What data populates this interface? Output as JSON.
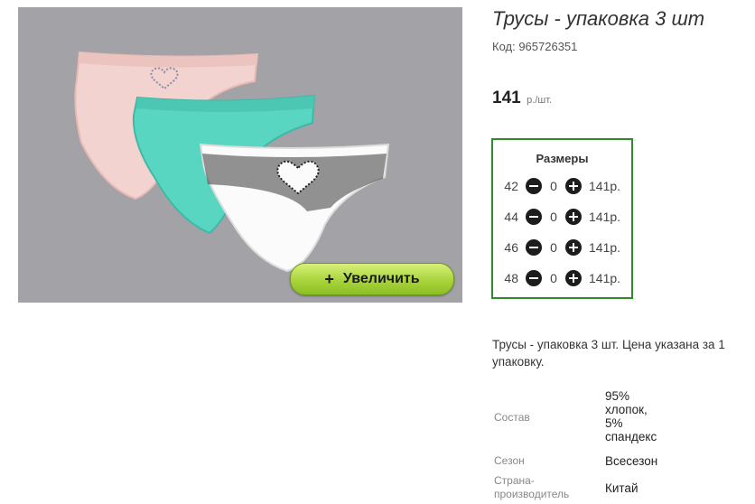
{
  "product": {
    "title": "Трусы - упаковка 3 шт",
    "sku": "Код: 965726351",
    "price": "141",
    "price_unit": "р./шт.",
    "zoom_label": "Увеличить",
    "zoom_icon": "+"
  },
  "sizes": {
    "header": "Размеры",
    "rows": [
      {
        "size": "42",
        "qty": "0",
        "price": "141р."
      },
      {
        "size": "44",
        "qty": "0",
        "price": "141р."
      },
      {
        "size": "46",
        "qty": "0",
        "price": "141р."
      },
      {
        "size": "48",
        "qty": "0",
        "price": "141р."
      }
    ]
  },
  "description": "Трусы - упаковка 3 шт. Цена указана за 1 упаковку.",
  "attributes": [
    {
      "label": "Состав",
      "value": "95% хлопок, 5% спандекс"
    },
    {
      "label": "Сезон",
      "value": "Всесезон"
    },
    {
      "label": "Страна-производитель",
      "value": "Китай"
    }
  ],
  "colors": {
    "frame": "#2e8b2e",
    "button": "#a8d43a",
    "photo_bg": "#a3a2a6"
  }
}
